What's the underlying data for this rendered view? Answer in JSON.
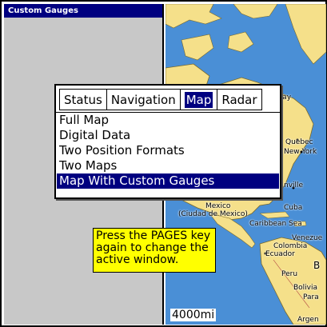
{
  "left_pane": {
    "title": "Custom Gauges"
  },
  "popup": {
    "tabs": [
      {
        "label": "Status",
        "active": false
      },
      {
        "label": "Navigation",
        "active": false
      },
      {
        "label": "Map",
        "active": true
      },
      {
        "label": "Radar",
        "active": false
      }
    ],
    "items": [
      {
        "label": "Full Map",
        "selected": false
      },
      {
        "label": "Digital Data",
        "selected": false
      },
      {
        "label": "Two Position Formats",
        "selected": false
      },
      {
        "label": "Two Maps",
        "selected": false
      },
      {
        "label": "Map With Custom Gauges",
        "selected": true
      }
    ]
  },
  "tooltip": {
    "text": "Press the PAGES key again to change the active window."
  },
  "map": {
    "scale": "4000mi",
    "labels": {
      "bay": "Bay",
      "quebec": "Quebec",
      "new_york": "New York",
      "nville": "nville",
      "mexico": "Mexico",
      "cuba": "Cuba",
      "ciudad": "(Ciudad de Mexico)",
      "caribbean": "Caribbean Sea",
      "venezuela": "Venezue",
      "colombia": "Colombia",
      "ecuador": "Ecuador",
      "b": "B",
      "peru": "Peru",
      "bolivia": "Bolivia",
      "para": "Para",
      "argen": "Argen"
    },
    "colors": {
      "water": "#4a8fd6",
      "land": "#f5e08a",
      "highlight": "#000080"
    }
  }
}
